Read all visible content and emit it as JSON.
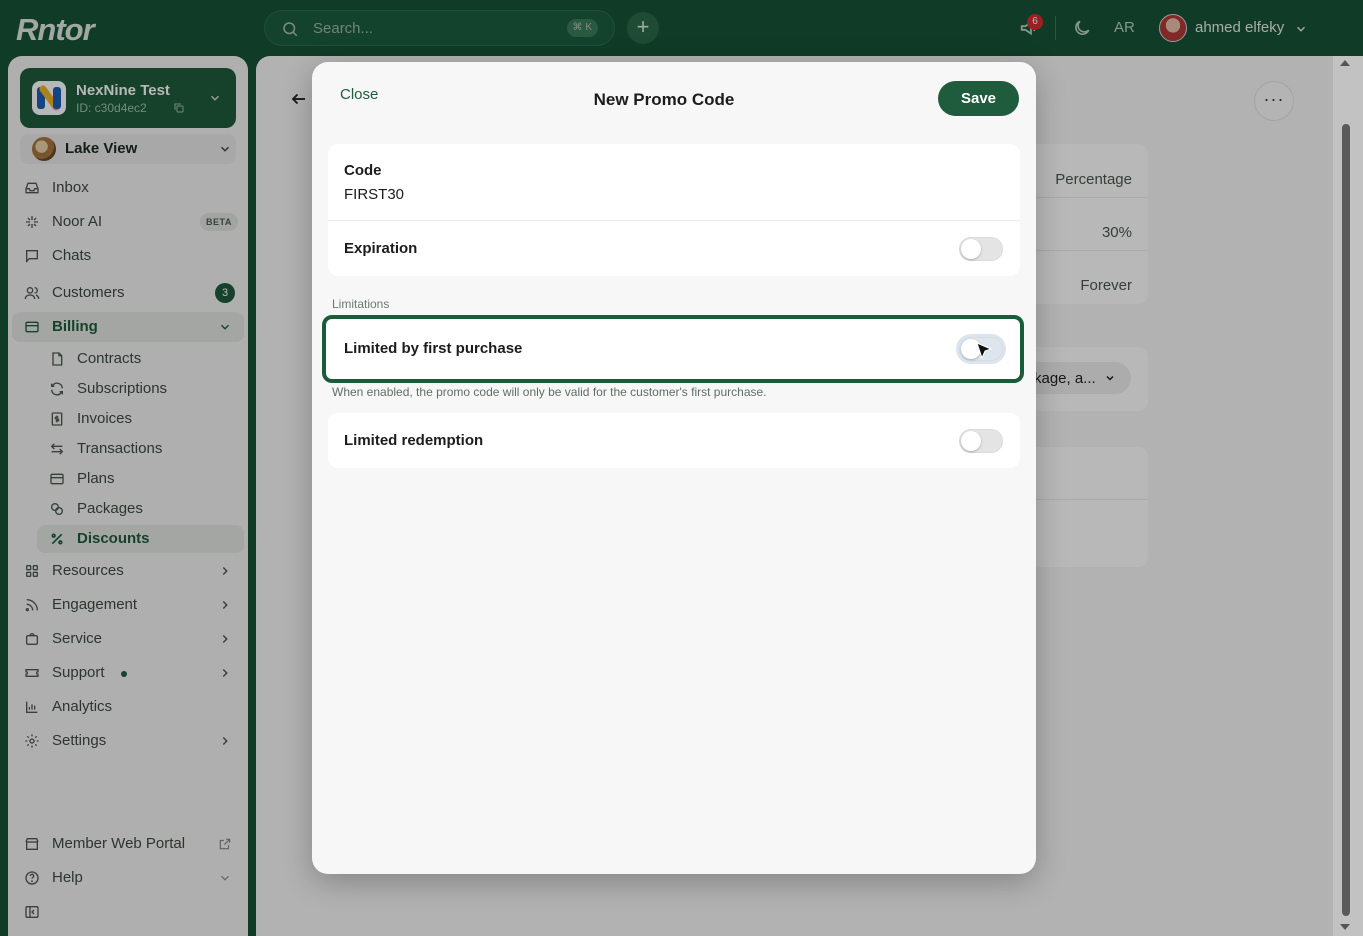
{
  "topbar": {
    "logo": "Rntor",
    "search_placeholder": "Search...",
    "search_shortcut": "⌘ K",
    "notifications_count": "6",
    "language": "AR",
    "username": "ahmed elfeky"
  },
  "sidebar": {
    "org_name": "NexNine Test",
    "org_id": "ID: c30d4ec2",
    "branch": "Lake View",
    "items": [
      {
        "label": "Inbox",
        "icon": "inbox-icon"
      },
      {
        "label": "Noor AI",
        "icon": "sparkle-icon",
        "badge": "BETA"
      },
      {
        "label": "Chats",
        "icon": "chat-icon"
      },
      {
        "label": "Customers",
        "icon": "users-icon",
        "count": "3"
      },
      {
        "label": "Billing",
        "icon": "card-icon"
      },
      {
        "label": "Resources",
        "icon": "grid-icon"
      },
      {
        "label": "Engagement",
        "icon": "rss-icon"
      },
      {
        "label": "Service",
        "icon": "bag-icon"
      },
      {
        "label": "Support",
        "icon": "ticket-icon"
      },
      {
        "label": "Analytics",
        "icon": "chart-icon"
      },
      {
        "label": "Settings",
        "icon": "gear-icon"
      }
    ],
    "billing_sub": [
      {
        "label": "Contracts",
        "icon": "file-icon"
      },
      {
        "label": "Subscriptions",
        "icon": "refresh-icon"
      },
      {
        "label": "Invoices",
        "icon": "invoice-icon"
      },
      {
        "label": "Transactions",
        "icon": "swap-icon"
      },
      {
        "label": "Plans",
        "icon": "card-icon"
      },
      {
        "label": "Packages",
        "icon": "packages-icon"
      },
      {
        "label": "Discounts",
        "icon": "percent-icon"
      }
    ],
    "footer": [
      {
        "label": "Member Web Portal",
        "icon": "store-icon"
      },
      {
        "label": "Help",
        "icon": "help-icon"
      }
    ]
  },
  "background": {
    "type_value": "Percentage",
    "amount_value": "30%",
    "duration_value": "Forever",
    "pill_text": "kage, a..."
  },
  "modal": {
    "close_label": "Close",
    "title": "New Promo Code",
    "save_label": "Save",
    "code_label": "Code",
    "code_value": "FIRST30",
    "expiration_label": "Expiration",
    "limitations_label": "Limitations",
    "first_purchase_label": "Limited by first purchase",
    "first_purchase_help": "When enabled, the promo code will only be valid for the customer's first purchase.",
    "redemption_label": "Limited redemption"
  },
  "colors": {
    "brand": "#175236",
    "accent": "#1f5c3e"
  }
}
